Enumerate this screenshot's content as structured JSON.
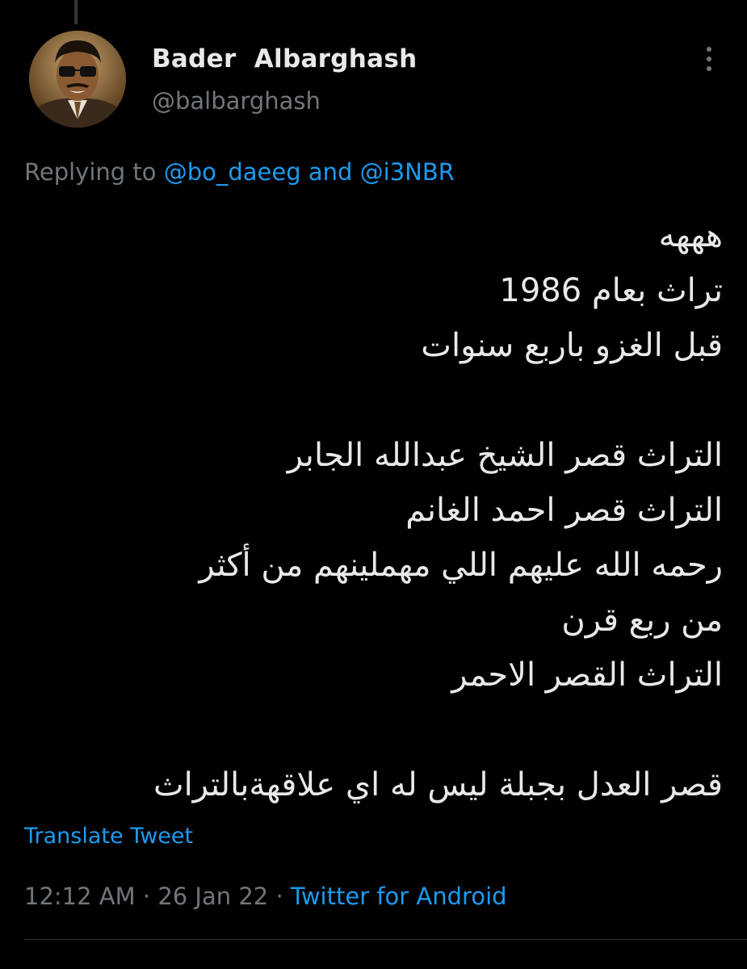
{
  "author": {
    "display_name": "Bader  Albarghash",
    "handle": "@balbarghash"
  },
  "reply_context": {
    "prefix": "Replying to ",
    "mention_1": "@bo_daeeg",
    "joiner": " and ",
    "mention_2": "@i3NBR"
  },
  "tweet": {
    "lines": [
      "هههه",
      "تراث بعام 1986",
      "قبل الغزو باربع سنوات",
      "",
      "التراث قصر الشيخ عبدالله الجابر",
      "التراث قصر احمد الغانم",
      "رحمه الله عليهم اللي مهملينهم من أكثر",
      "من ربع قرن",
      "التراث القصر الاحمر",
      "",
      "قصر العدل بجبلة ليس له اي علاقهةبالتراث"
    ]
  },
  "translate_label": "Translate Tweet",
  "meta": {
    "time": "12:12 AM",
    "sep1": " · ",
    "date": "26 Jan 22",
    "sep2": " · ",
    "source": "Twitter for Android"
  },
  "icons": {
    "more": "more-vertical-icon"
  },
  "colors": {
    "background": "#000000",
    "text": "#e7e9ea",
    "secondary": "#71767b",
    "link": "#1d9bf0"
  }
}
